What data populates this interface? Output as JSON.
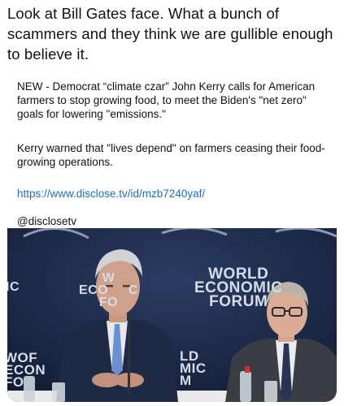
{
  "post": {
    "text": "Look at Bill Gates face. What a bunch of scammers and they think we are gullible enough to believe it."
  },
  "quoted": {
    "paragraph1": "NEW - Democrat “climate czar” John Kerry calls for American farmers to stop growing food, to meet the Biden's \"net zero\" goals for lowering \"emissions.\"",
    "paragraph2": "Kerry warned that \"lives depend\" on farmers ceasing their food-growing operations.",
    "link": "https://www.disclose.tv/id/mzb7240yaf/",
    "handle": "@disclosetv"
  },
  "media": {
    "watermark_main": [
      "WORLD",
      "ECONOMIC",
      "FORUM"
    ],
    "watermark_center": [
      "W",
      "ECO     C",
      "FO"
    ],
    "watermark_left": "IC",
    "watermark_bottom_left": [
      "WOF",
      "ECON",
      "FO"
    ],
    "watermark_bottom_center": [
      "LD",
      "MIC",
      "M"
    ]
  },
  "colors": {
    "link": "#1d6fb8",
    "backdrop": "#1c2a4a"
  }
}
